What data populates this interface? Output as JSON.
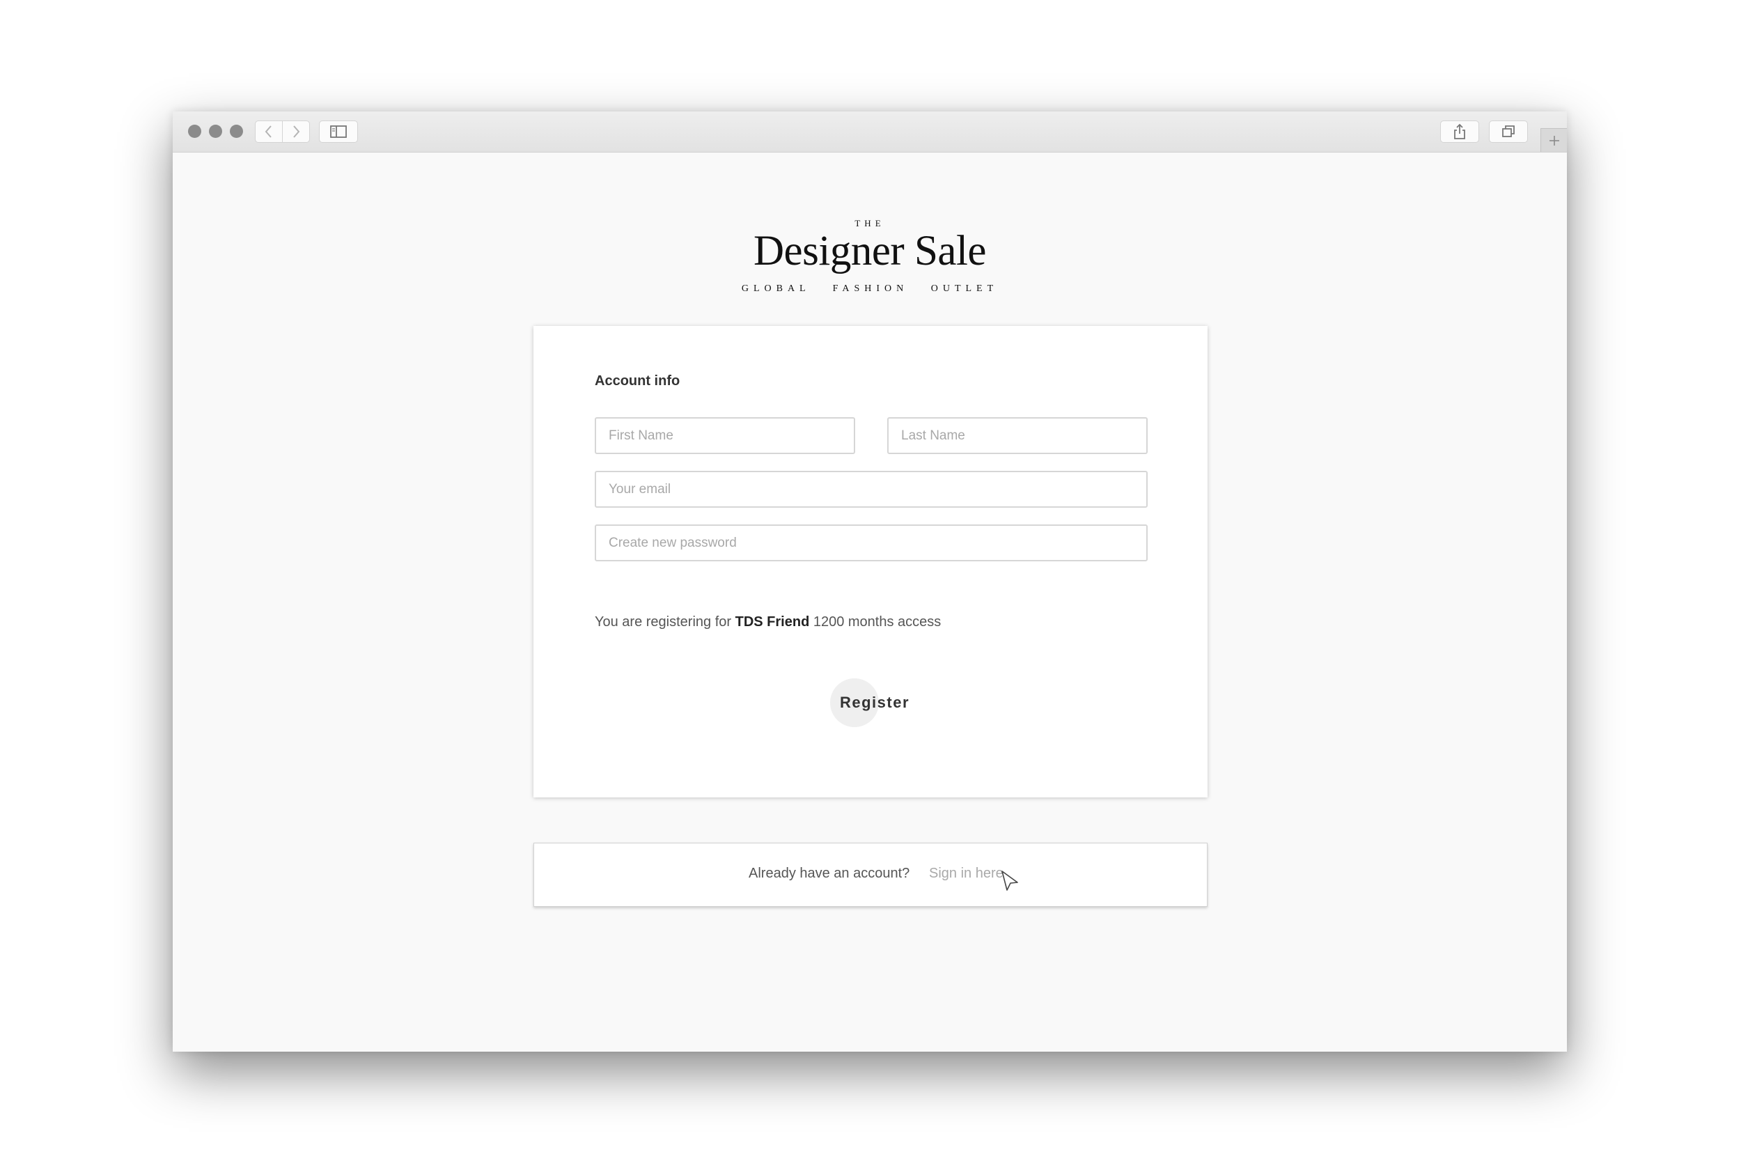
{
  "browser": {
    "icons": {
      "back": "chevron-left-icon",
      "forward": "chevron-right-icon",
      "sidebar": "sidebar-icon",
      "share": "share-icon",
      "tabs": "tabs-icon",
      "new_tab": "plus-icon"
    }
  },
  "brand": {
    "the": "THE",
    "name": "Designer Sale",
    "tagline": "GLOBAL FASHION OUTLET"
  },
  "form": {
    "section_title": "Account info",
    "first_name_placeholder": "First Name",
    "last_name_placeholder": "Last Name",
    "email_placeholder": "Your email",
    "password_placeholder": "Create new password",
    "note_prefix": "You are registering for ",
    "plan_name": "TDS Friend",
    "note_suffix": " 1200 months access",
    "register_label": "Register"
  },
  "signin": {
    "prompt": "Already have an account?",
    "link": "Sign in here."
  },
  "colors": {
    "page_bg": "#f9f9f9",
    "card_bg": "#ffffff",
    "text": "#333333",
    "muted_link": "#a9a9a9",
    "button_circle": "#efefef"
  }
}
